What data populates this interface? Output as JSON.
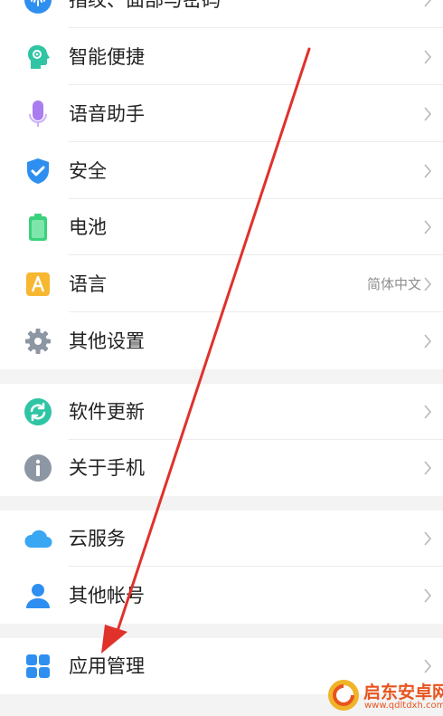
{
  "settings": {
    "items": [
      {
        "label": "指纹、面部与密码",
        "value": "",
        "icon": "fingerprint-icon"
      },
      {
        "label": "智能便捷",
        "value": "",
        "icon": "smart-head-icon"
      },
      {
        "label": "语音助手",
        "value": "",
        "icon": "microphone-icon"
      },
      {
        "label": "安全",
        "value": "",
        "icon": "shield-check-icon"
      },
      {
        "label": "电池",
        "value": "",
        "icon": "battery-icon"
      },
      {
        "label": "语言",
        "value": "简体中文",
        "icon": "language-a-icon"
      },
      {
        "label": "其他设置",
        "value": "",
        "icon": "gear-icon"
      },
      {
        "label": "软件更新",
        "value": "",
        "icon": "sync-update-icon"
      },
      {
        "label": "关于手机",
        "value": "",
        "icon": "info-icon"
      },
      {
        "label": "云服务",
        "value": "",
        "icon": "cloud-icon"
      },
      {
        "label": "其他帐号",
        "value": "",
        "icon": "person-icon"
      },
      {
        "label": "应用管理",
        "value": "",
        "icon": "app-grid-icon"
      }
    ]
  },
  "watermark": {
    "title": "启东安卓网",
    "url": "www.qdltdxh.com"
  },
  "colors": {
    "annotation_arrow": "#e0312b",
    "icon_teal": "#2fc4a4",
    "icon_purple": "#a97df0",
    "icon_blue": "#2f8ff0",
    "icon_green": "#39d27a",
    "icon_orange": "#f7b731",
    "icon_gray": "#8d96a3",
    "icon_cloud": "#3aa7f2"
  }
}
